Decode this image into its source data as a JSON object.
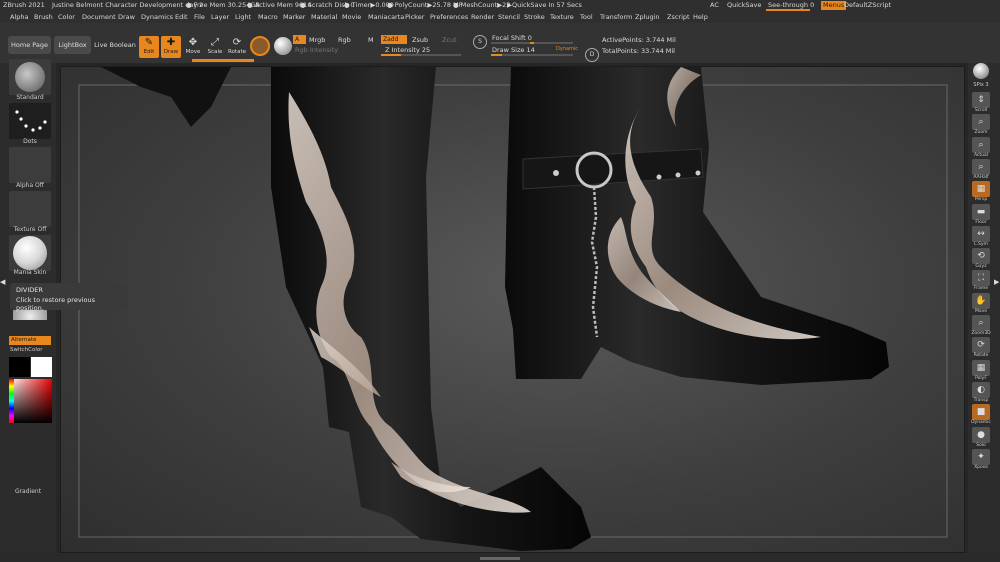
{
  "title_bar": {
    "app": "ZBrush 2021",
    "document": "Justine Belmont Character Development day 2",
    "free_mem": "● Free Mem 30.254GB",
    "active_mem": "● Active Mem 9614",
    "scratch_disk": "● Scratch Disk 0",
    "timer": "● Timer▶0.009",
    "polycount": "● PolyCount▶25.78 MP",
    "meshcount": "● MeshCount▶23",
    "quicksave_timer": "▶QuickSave In 57 Secs",
    "ac": "AC",
    "quicksave": "QuickSave",
    "see_through": "See-through  0",
    "menus": "Menus",
    "script": "DefaultZScript"
  },
  "menu_bar": {
    "items": [
      "Alpha",
      "Brush",
      "Color",
      "Document",
      "Draw",
      "Dynamics",
      "Edit",
      "File",
      "Layer",
      "Light",
      "Macro",
      "Marker",
      "Material",
      "Movie",
      "Maniacarta",
      "Picker",
      "Preferences",
      "Render",
      "Stencil",
      "Stroke",
      "Texture",
      "Tool",
      "Transform",
      "Zplugin",
      "Zscript",
      "Help"
    ]
  },
  "toolbar": {
    "home_page": "Home Page",
    "lightbox": "LightBox",
    "live_boolean": "Live Boolean",
    "edit": "Edit",
    "draw": "Draw",
    "move": "Move",
    "scale": "Scale",
    "rotate": "Rotate",
    "a": "A",
    "mrgb": "Mrgb",
    "rgb": "Rgb",
    "m": "M",
    "rgb_intensity": "Rgb Intensity",
    "zadd": "Zadd",
    "zsub": "Zsub",
    "zcut": "Zcut",
    "z_intensity": "Z Intensity 25",
    "s": "S",
    "d": "D",
    "focal_shift": "Focal Shift 0",
    "draw_size": "Draw Size 14",
    "dynamic": "Dynamic",
    "active_points": "ActivePoints: 3.744 Mil",
    "total_points": "TotalPoints: 33.744 Mil",
    "z_intensity_value": 25,
    "focal_shift_value": 0,
    "draw_size_value": 14
  },
  "left_panel": {
    "standard": "Standard",
    "dots": "Dots",
    "alpha_off": "Alpha Off",
    "texture_off": "Texture Off",
    "mania_skin": "Mania Skin",
    "alternate": "Alternate",
    "switch_color": "SwitchColor",
    "gradient": "Gradient"
  },
  "tooltip": {
    "title": "DIVIDER",
    "text": "Click to restore previous position."
  },
  "right_panel": {
    "spix": "SPix 3",
    "buttons": [
      {
        "label": "Scroll",
        "icon": "⇕"
      },
      {
        "label": "Zoom",
        "icon": "⌕"
      },
      {
        "label": "Actual",
        "icon": "⌕"
      },
      {
        "label": "AAHalf",
        "icon": "⌕"
      },
      {
        "label": "Persp",
        "icon": "▦"
      },
      {
        "label": "Floor",
        "icon": "▬"
      },
      {
        "label": "L.Sym",
        "icon": "↔"
      },
      {
        "label": "Gxyz",
        "icon": "⟲"
      },
      {
        "label": "Frame",
        "icon": "⛶"
      },
      {
        "label": "Move",
        "icon": "✋"
      },
      {
        "label": "Zoom3D",
        "icon": "⌕"
      },
      {
        "label": "Rotate",
        "icon": "⟳"
      },
      {
        "label": "PolyF",
        "icon": "▦"
      },
      {
        "label": "Transp",
        "icon": "◐"
      },
      {
        "label": "Dynamic",
        "icon": "■"
      },
      {
        "label": "Solo",
        "icon": "●"
      },
      {
        "label": "Xpose",
        "icon": "✦"
      }
    ]
  },
  "colors": {
    "accent": "#e8871e",
    "panel": "#2c2c2c",
    "boot_leather": "#121212",
    "inlay_metal": "#c9b6a8"
  }
}
